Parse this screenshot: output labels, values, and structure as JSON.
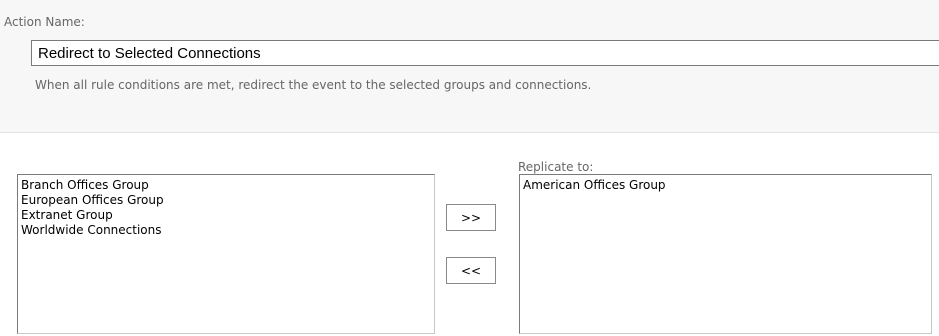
{
  "action_name": {
    "label": "Action Name:",
    "value": "Redirect to Selected Connections",
    "description": "When all rule conditions are met, redirect the event to the selected groups and connections."
  },
  "available": {
    "items": [
      "Branch Offices Group",
      "European Offices Group",
      "Extranet Group",
      "Worldwide Connections"
    ]
  },
  "buttons": {
    "add_label": ">>",
    "remove_label": "<<"
  },
  "selected": {
    "label": "Replicate to:",
    "items": [
      "American Offices Group"
    ]
  }
}
